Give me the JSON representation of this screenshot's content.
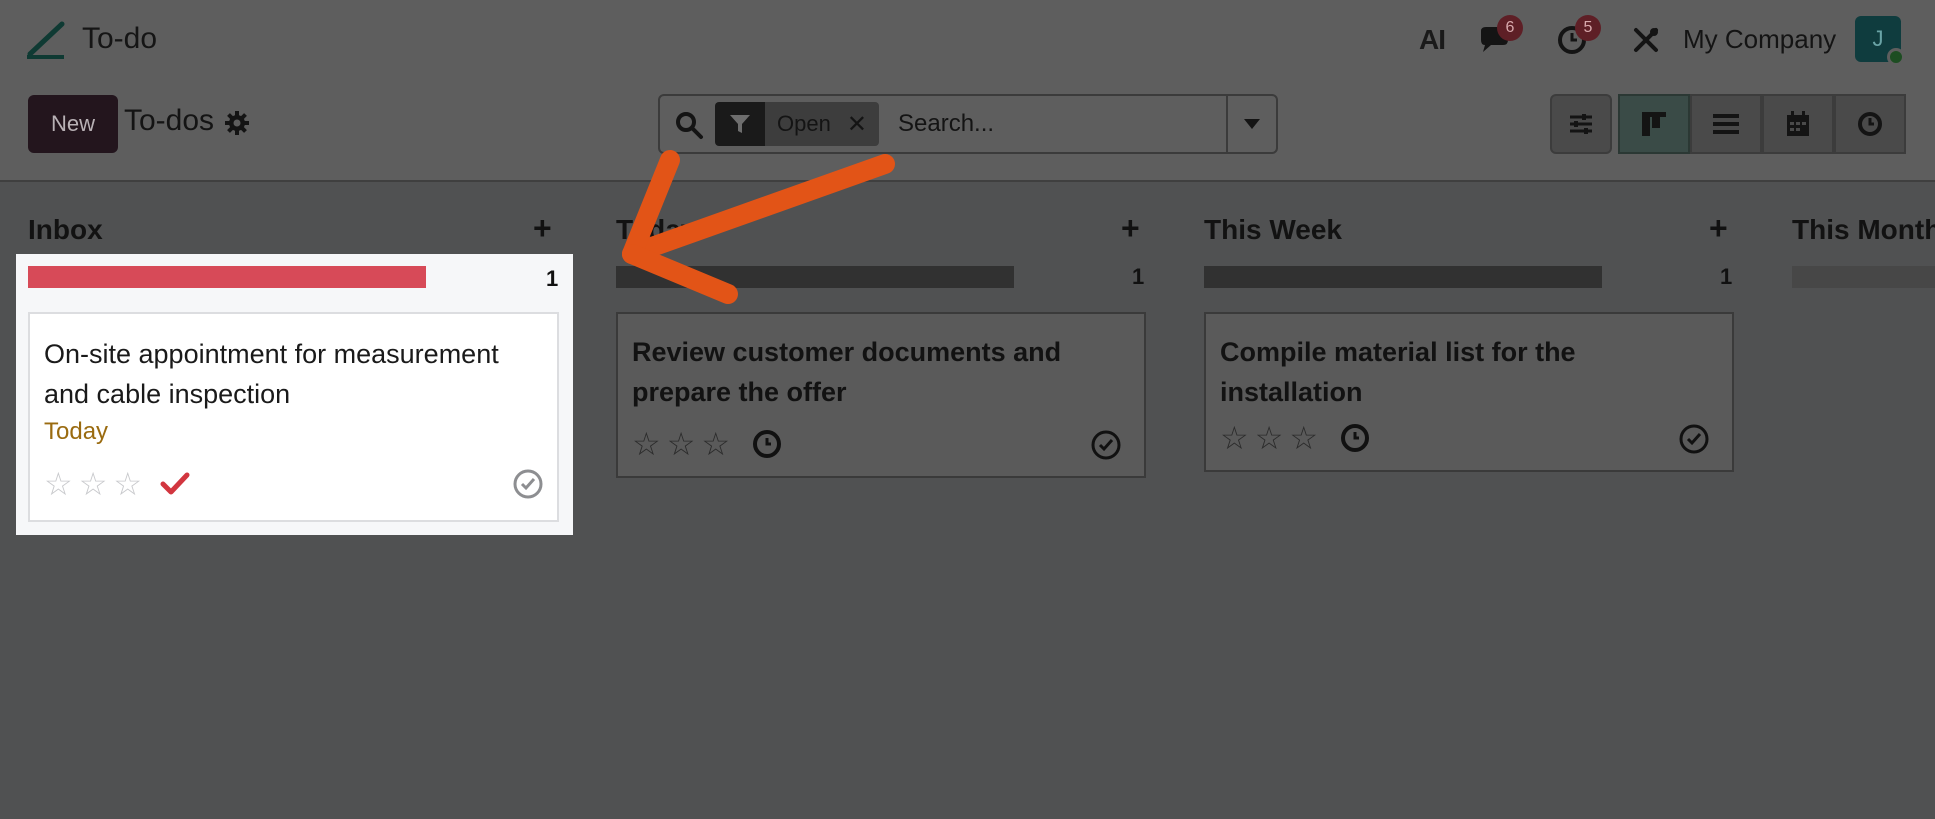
{
  "app": {
    "name": "To-do",
    "company": "My Company",
    "avatar_initial": "J"
  },
  "systray": {
    "ai_label": "AI",
    "messages": {
      "icon": "chat-icon",
      "count": "6"
    },
    "activities": {
      "icon": "clock-icon",
      "count": "5"
    },
    "debug_icon": "tools-icon"
  },
  "control": {
    "new_label": "New",
    "title": "To-dos",
    "search": {
      "facet_label": "Open",
      "placeholder": "Search..."
    }
  },
  "views": [
    "kanban",
    "list",
    "calendar",
    "activity"
  ],
  "columns": [
    {
      "title": "Inbox",
      "count": "1",
      "bar_color": "#d74a58",
      "cards": [
        {
          "title_line1": "On-site appointment for measurement",
          "title_line2": "and cable inspection",
          "deadline": "Today"
        }
      ]
    },
    {
      "title": "Today",
      "count": "1",
      "cards": [
        {
          "title_line1": "Review customer documents and",
          "title_line2": "prepare the offer"
        }
      ]
    },
    {
      "title": "This Week",
      "count": "1",
      "cards": [
        {
          "title_line1": "Compile material list for the installation"
        }
      ]
    },
    {
      "title": "This Month",
      "count": "",
      "cards": []
    }
  ],
  "colors": {
    "accent_arrow": "#e25417",
    "deadline": "#9a6b10",
    "inbox_bar": "#d74a58"
  }
}
